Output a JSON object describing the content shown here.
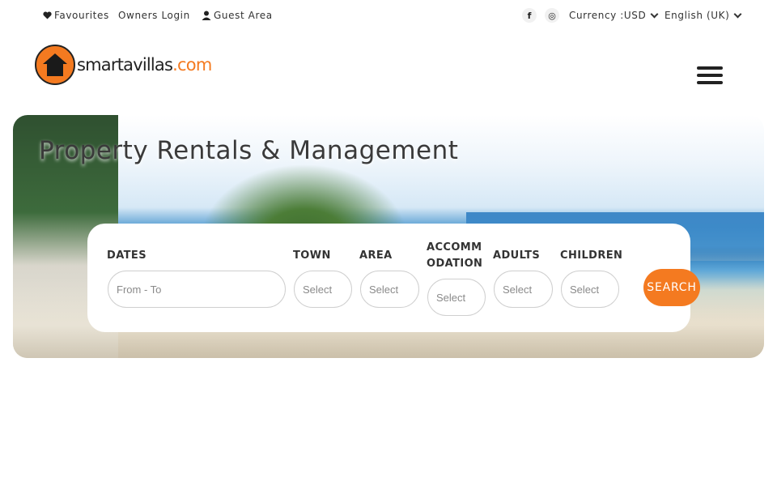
{
  "topbar": {
    "favourites": "Favourites",
    "owners_login": "Owners Login",
    "guest_area": "Guest Area",
    "facebook_glyph": "f",
    "instagram_glyph": "◎",
    "currency": "Currency :USD",
    "language": "English (UK)"
  },
  "logo": {
    "name": "smartavillas",
    "tld": ".com"
  },
  "hero": {
    "title": "Property Rentals & Management"
  },
  "search": {
    "dates": {
      "label": "DATES",
      "placeholder": "From - To"
    },
    "town": {
      "label": "TOWN",
      "value": "Select"
    },
    "area": {
      "label": "AREA",
      "value": "Select"
    },
    "accommodation": {
      "label_line1": "ACCOMM",
      "label_line2": "ODATION",
      "value": "Select"
    },
    "adults": {
      "label": "ADULTS",
      "value": "Select"
    },
    "children": {
      "label": "CHILDREN",
      "value": "Select"
    },
    "button": "SEARCH"
  },
  "colors": {
    "accent": "#f47a20",
    "text": "#333333"
  }
}
